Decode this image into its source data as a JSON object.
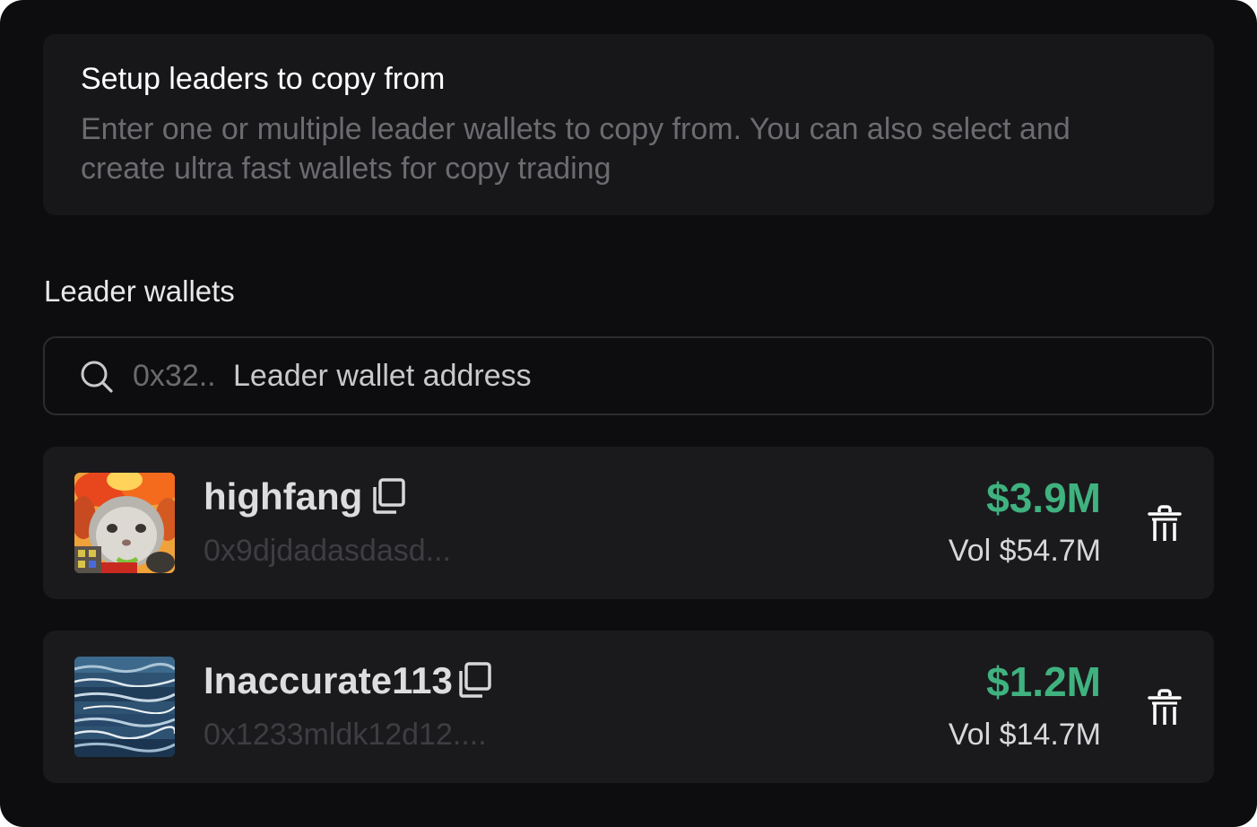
{
  "intro": {
    "title": "Setup leaders to copy from",
    "description_line1": "Enter one or multiple leader wallets to copy from. You can also select and",
    "description_line2": "create ultra fast wallets for copy trading"
  },
  "leaders_section": {
    "label": "Leader wallets"
  },
  "search": {
    "icon": "search-icon",
    "prefix": "0x32..",
    "placeholder": "Leader wallet address"
  },
  "leaders": [
    {
      "name": "highfang",
      "address": "0x9djdadasdasd...",
      "value": "$3.9M",
      "volume": "Vol $54.7M",
      "avatar": "cat-on-fire-avatar"
    },
    {
      "name": "Inaccurate113",
      "address": "0x1233mldk12d12....",
      "value": "$1.2M",
      "volume": "Vol $14.7M",
      "avatar": "ocean-waves-avatar"
    }
  ],
  "colors": {
    "background": "#0d0d0f",
    "card": "#1a1a1d",
    "accent_green": "#3fb27f"
  }
}
